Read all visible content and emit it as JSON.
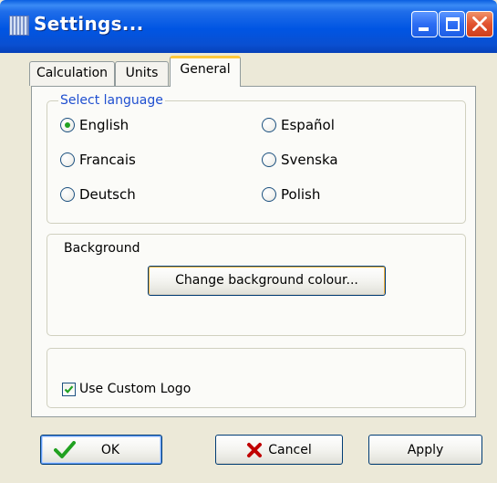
{
  "window": {
    "title": "Settings..."
  },
  "title_buttons": [
    "minimize",
    "maximize",
    "close"
  ],
  "tabs": [
    {
      "label": "Calculation",
      "selected": false
    },
    {
      "label": "Units",
      "selected": false
    },
    {
      "label": "General",
      "selected": true
    }
  ],
  "language_group": {
    "legend": "Select language",
    "options": [
      {
        "label": "English",
        "checked": true
      },
      {
        "label": "Español",
        "checked": false
      },
      {
        "label": "Francais",
        "checked": false
      },
      {
        "label": "Svenska",
        "checked": false
      },
      {
        "label": "Deutsch",
        "checked": false
      },
      {
        "label": "Polish",
        "checked": false
      }
    ]
  },
  "background_group": {
    "label": "Background",
    "change_button_label": "Change background colour..."
  },
  "logo_group": {
    "checkbox_label": "Use Custom Logo",
    "checked": true
  },
  "buttons": {
    "ok_label": "OK",
    "cancel_label": "Cancel",
    "apply_label": "Apply"
  },
  "icons": {
    "ok": "checkmark-icon",
    "cancel": "x-icon",
    "window": "app-icon"
  },
  "colors": {
    "titlebar": "#0055E3",
    "dialog_bg": "#ECE9D8",
    "legend_text": "#1F4FD0",
    "selected_tab_accent": "#FFC83C",
    "ok_check": "#21A121",
    "cancel_x": "#C00000"
  }
}
